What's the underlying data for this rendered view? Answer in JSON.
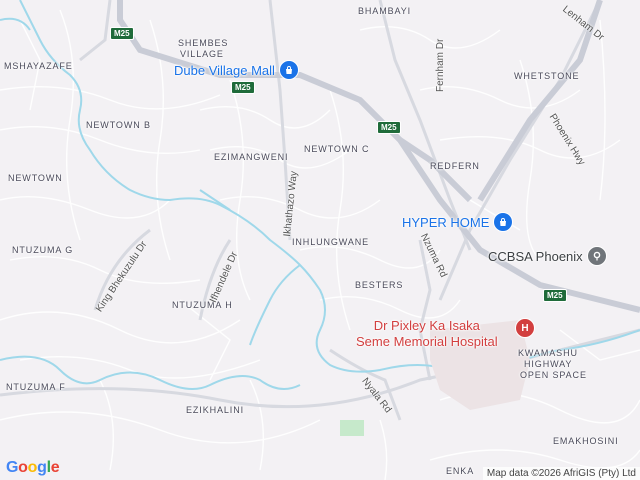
{
  "colors": {
    "land": "#f3f1f4",
    "road": "#ffffff",
    "major_road": "#c9ccd6",
    "river": "#9fd8ea",
    "shield": "#1f6b3a",
    "poi_blue": "#1a73e8",
    "poi_gray": "#70757a",
    "hospital": "#d23f3f"
  },
  "areas": [
    {
      "id": "bhambayi",
      "label": "BHAMBAYI"
    },
    {
      "id": "shembes",
      "label": "SHEMBES"
    },
    {
      "id": "village",
      "label": "VILLAGE"
    },
    {
      "id": "mshayazafe",
      "label": "MSHAYAZAFE"
    },
    {
      "id": "newtown-b",
      "label": "NEWTOWN B"
    },
    {
      "id": "ezimangweni",
      "label": "EZIMANGWENI"
    },
    {
      "id": "newtown-c",
      "label": "NEWTOWN C"
    },
    {
      "id": "whetstone",
      "label": "WHETSTONE"
    },
    {
      "id": "redfern",
      "label": "REDFERN"
    },
    {
      "id": "newtown",
      "label": "NEWTOWN"
    },
    {
      "id": "inhlungwane",
      "label": "INHLUNGWANE"
    },
    {
      "id": "ntuzuma-g",
      "label": "NTUZUMA G"
    },
    {
      "id": "besters",
      "label": "BESTERS"
    },
    {
      "id": "ntuzuma-h",
      "label": "NTUZUMA H"
    },
    {
      "id": "kwamashu-1",
      "label": "KWAMASHU"
    },
    {
      "id": "kwamashu-2",
      "label": "HIGHWAY"
    },
    {
      "id": "kwamashu-3",
      "label": "OPEN SPACE"
    },
    {
      "id": "ntuzuma-f",
      "label": "NTUZUMA F"
    },
    {
      "id": "ezikhalini",
      "label": "EZIKHALINI"
    },
    {
      "id": "emakhosini",
      "label": "EMAKHOSINI"
    },
    {
      "id": "enka",
      "label": "ENKA"
    }
  ],
  "streets": [
    {
      "id": "lenham",
      "label": "Lenham Dr"
    },
    {
      "id": "fernham",
      "label": "Fernham Dr"
    },
    {
      "id": "phoenix",
      "label": "Phoenix Hwy"
    },
    {
      "id": "ikhathazo",
      "label": "Ikhathazo Way"
    },
    {
      "id": "ifhendele",
      "label": "Ifhendele Dr"
    },
    {
      "id": "kingbhekuzulu",
      "label": "King Bhekuzulu Dr"
    },
    {
      "id": "nzuma",
      "label": "Nzuma Rd"
    },
    {
      "id": "nyala",
      "label": "Nyala Rd"
    }
  ],
  "shields": [
    {
      "id": "m25-1",
      "label": "M25"
    },
    {
      "id": "m25-2",
      "label": "M25"
    },
    {
      "id": "m25-3",
      "label": "M25"
    },
    {
      "id": "m25-4",
      "label": "M25"
    }
  ],
  "pois": {
    "dube": {
      "label": "Dube Village Mall",
      "icon": "shopping-bag-icon"
    },
    "hyper": {
      "label": "HYPER HOME",
      "icon": "shopping-bag-icon"
    },
    "ccbsa": {
      "label": "CCBSA Phoenix",
      "icon": "map-pin-icon"
    },
    "hospital": {
      "line1": "Dr Pixley Ka Isaka",
      "line2": "Seme Memorial Hospital",
      "icon": "hospital-icon",
      "glyph": "H"
    }
  },
  "footer": {
    "logo": "Google",
    "attribution": "Map data ©2026 AfriGIS (Pty) Ltd"
  }
}
